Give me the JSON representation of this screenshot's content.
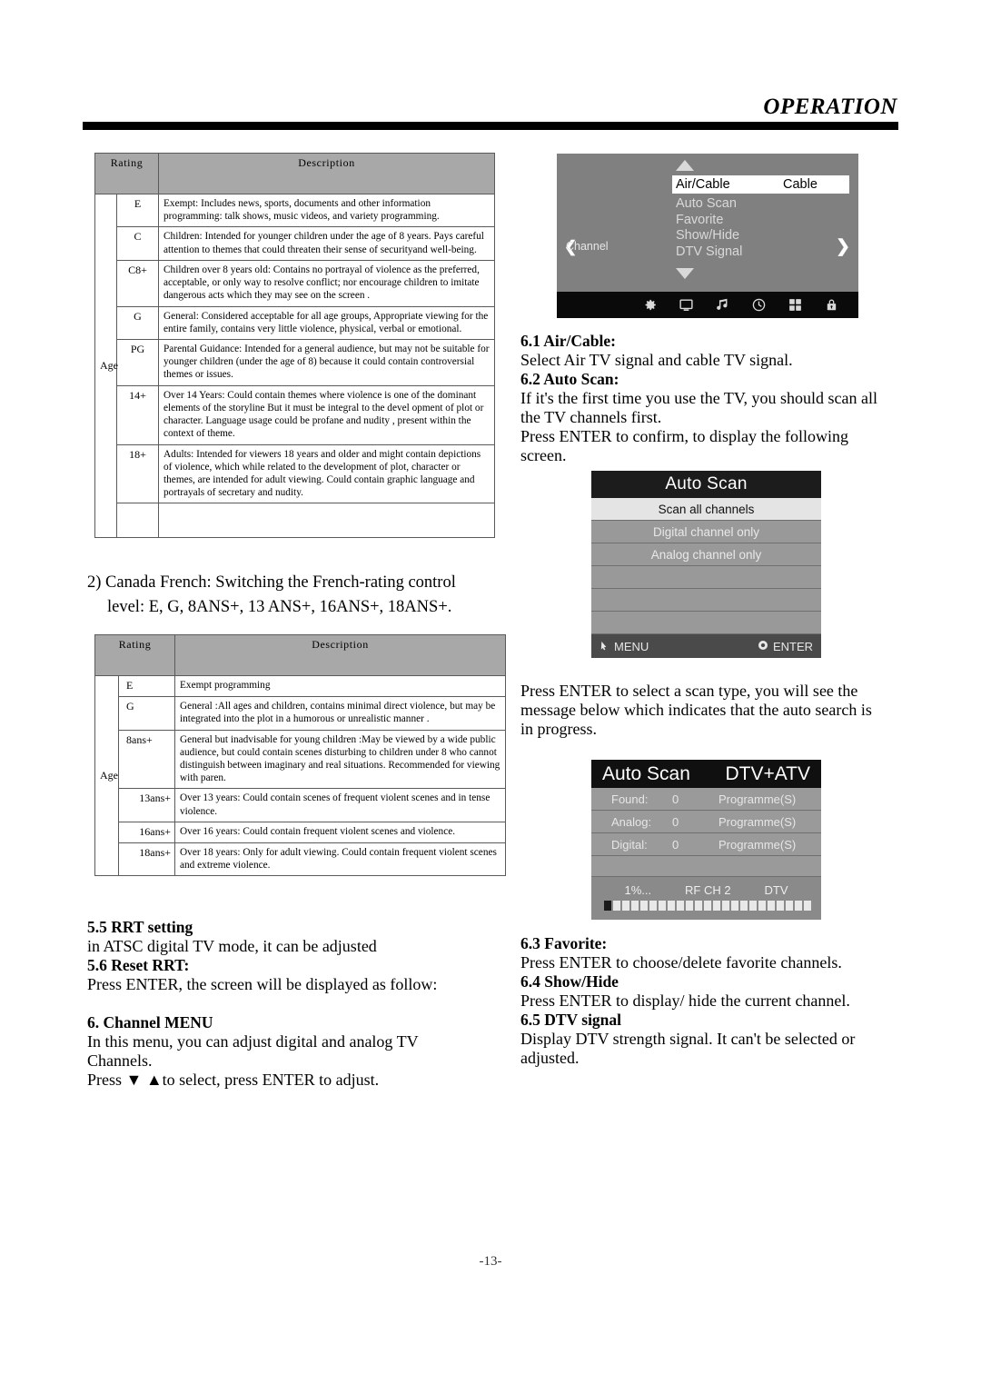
{
  "header": {
    "title": "OPERATION"
  },
  "page_number": "-13-",
  "tables": {
    "canada_english": {
      "columns": [
        "Rating",
        "Description"
      ],
      "age_label": "Age",
      "rows": [
        {
          "rating": "E",
          "description": "Exempt: Includes news, sports, documents and other information programming: talk shows, music videos, and variety programming."
        },
        {
          "rating": "C",
          "description": "Children: Intended for younger children under the age of 8 years. Pays careful attention to themes that could threaten their sense of securityand well-being."
        },
        {
          "rating": "C8+",
          "description": "Children over 8 years old: Contains no portrayal of violence as the preferred, acceptable, or only way to resolve conflict; nor encourage children to imitate dangerous acts which they may see on the screen ."
        },
        {
          "rating": "G",
          "description": "General: Considered acceptable for all age groups, Appropriate viewing for the entire family, contains very little violence, physical, verbal or emotional."
        },
        {
          "rating": "PG",
          "description": "Parental Guidance: Intended for a general audience, but may not be suitable for younger children (under the age of 8) because it could contain controversial themes or issues."
        },
        {
          "rating": "14+",
          "description": "Over 14 Years: Could contain themes where violence is one of the dominant elements of the storyline But it must be integral to the devel opment of plot or character. Language usage could be profane and nudity , present within the context of theme."
        },
        {
          "rating": "18+",
          "description": "Adults: Intended for viewers 18 years and older and might contain depictions of  violence, which while related to the development of plot,  character or themes, are intended for adult  viewing. Could contain graphic language and portrayals of secretary and nudity."
        }
      ]
    },
    "canada_french": {
      "columns": [
        "Rating",
        "Description"
      ],
      "age_label": "Age",
      "rows": [
        {
          "rating": "E",
          "description": "Exempt programming"
        },
        {
          "rating": "G",
          "description": "General :All ages and children, contains minimal direct violence, but may be integrated into the plot in a humorous or unrealistic manner ."
        },
        {
          "rating": "8ans+",
          "description": "General but inadvisable for young children :May be viewed by a wide public audience, but could contain scenes disturbing to children under 8 who cannot distinguish between imaginary and real situations. Recommended for viewing with paren."
        },
        {
          "rating": "13ans+",
          "description": "Over 13 years: Could contain scenes of frequent violent scenes and in tense violence."
        },
        {
          "rating": "16ans+",
          "description": "Over 16 years: Could contain frequent violent scenes and violence."
        },
        {
          "rating": "18ans+",
          "description": "Over 18 years: Only for adult viewing. Could contain frequent violent  scenes and extreme violence."
        }
      ]
    }
  },
  "left_column": {
    "note_canada_french_line1": "2) Canada French: Switching the French-rating control",
    "note_canada_french_line2": "level: E, G, 8ANS+, 13 ANS+, 16ANS+, 18ANS+.",
    "sec_5_5_heading": "5.5 RRT setting",
    "sec_5_5_body": "in ATSC digital TV mode, it can be adjusted",
    "sec_5_6_heading": "5.6 Reset RRT:",
    "sec_5_6_body": "Press ENTER, the screen will be displayed as follow:",
    "sec_6_heading": "6. Channel MENU",
    "sec_6_body_line1": "In this menu, you can adjust digital and analog TV",
    "sec_6_body_line2": "Channels.",
    "sec_6_body_line3": "Press ▼ ▲to select, press ENTER to adjust."
  },
  "right_column": {
    "sec_6_1_heading": "6.1 Air/Cable:",
    "sec_6_1_body": "Select Air TV signal and cable TV signal.",
    "sec_6_2_heading": "6.2 Auto Scan:",
    "sec_6_2_body_line1": "If it's the first time you use the TV, you should scan all",
    "sec_6_2_body_line2": "the TV channels first.",
    "sec_6_2_body_line3": "Press ENTER to confirm, to display the following",
    "sec_6_2_body_line4": "screen.",
    "scan_note_line1": "Press ENTER to select a scan type, you will see the",
    "scan_note_line2": "message below which indicates that the auto search is",
    "scan_note_line3": "in progress.",
    "sec_6_3_heading": "6.3 Favorite:",
    "sec_6_3_body": "Press ENTER to choose/delete  favorite channels.",
    "sec_6_4_heading": "6.4 Show/Hide",
    "sec_6_4_body": "Press ENTER to display/ hide the current channel.",
    "sec_6_5_heading": "6.5 DTV signal",
    "sec_6_5_body_line1": "Display DTV strength signal. It can't be selected or",
    "sec_6_5_body_line2": "adjusted."
  },
  "osd_channel_menu": {
    "left_label": "Channel",
    "selected_item_label": "Air/Cable",
    "selected_item_value": "Cable",
    "items": [
      "Auto Scan",
      "Favorite",
      "Show/Hide",
      "DTV Signal"
    ],
    "icons": [
      "gear-icon",
      "monitor-icon",
      "music-note-icon",
      "clock-icon",
      "grid-icon",
      "lock-icon"
    ],
    "colors": {
      "panel_bg": "#808080",
      "iconbar_bg": "#0a0a0a",
      "highlight_bg": "#ffffff",
      "text": "#d9d9d9"
    }
  },
  "osd_auto_scan": {
    "title": "Auto Scan",
    "items": [
      {
        "label": "Scan all channels",
        "selected": true
      },
      {
        "label": "Digital channel only",
        "selected": false
      },
      {
        "label": "Analog channel only",
        "selected": false
      },
      {
        "label": "",
        "selected": false
      },
      {
        "label": "",
        "selected": false
      },
      {
        "label": "",
        "selected": false
      }
    ],
    "footer_menu_label": "MENU",
    "footer_enter_label": "ENTER",
    "colors": {
      "title_bg": "#1c1c1c",
      "row_bg": "#999999",
      "selected_bg": "#e4e4e4",
      "footer_bg": "#4a4a4a"
    }
  },
  "osd_auto_scan_progress": {
    "title": "Auto Scan",
    "mode": "DTV+ATV",
    "rows": [
      {
        "label": "Found:",
        "count": "0",
        "unit": "Programme(S)"
      },
      {
        "label": "Analog:",
        "count": "0",
        "unit": "Programme(S)"
      },
      {
        "label": "Digital:",
        "count": "0",
        "unit": "Programme(S)"
      }
    ],
    "progress_percent": "1%...",
    "rf_channel": "RF CH 2",
    "signal_type": "DTV",
    "progress_segments_total": 23,
    "progress_segments_filled": 1,
    "colors": {
      "title_bg": "#101010",
      "row_bg": "#9a9a9a",
      "progress_bg": "#8a8a8a"
    }
  }
}
